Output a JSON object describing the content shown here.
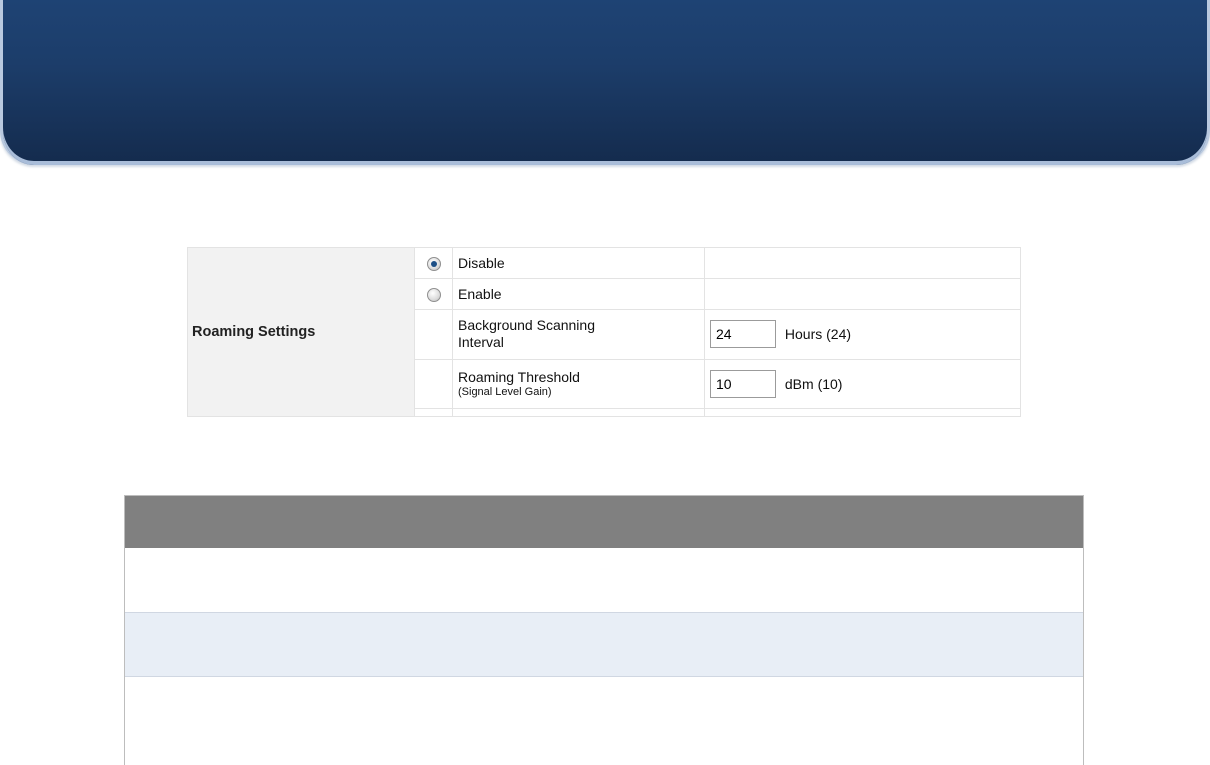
{
  "roaming": {
    "section_label": "Roaming Settings",
    "options": [
      {
        "label": "Disable",
        "selected": true
      },
      {
        "label": "Enable",
        "selected": false
      }
    ],
    "interval": {
      "label_line1": "Background Scanning",
      "label_line2": "Interval",
      "value": "24",
      "unit": "Hours (24)"
    },
    "threshold": {
      "label": "Roaming Threshold",
      "sublabel": "(Signal Level Gain)",
      "value": "10",
      "unit": "dBm (10)"
    }
  },
  "colors": {
    "banner_top": "#1f4577",
    "banner_bottom": "#142b4d",
    "table_header": "#808080",
    "row_alt": "#e8eef6"
  }
}
